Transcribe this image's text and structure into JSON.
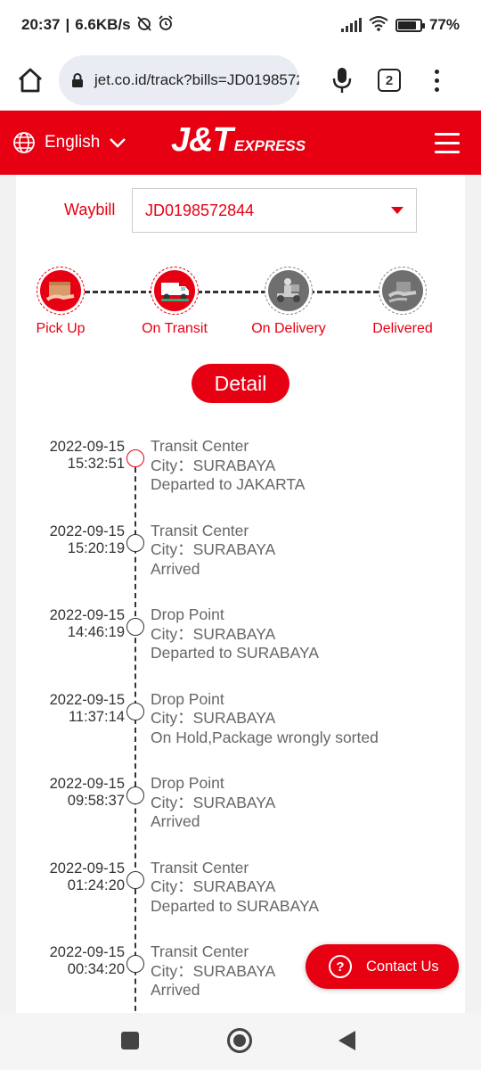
{
  "status_bar": {
    "time": "20:37",
    "network_speed": "6.6KB/s",
    "battery": "77",
    "battery_fraction": 0.77
  },
  "browser": {
    "url": "jet.co.id/track?bills=JD0198572",
    "tab_count": "2"
  },
  "header": {
    "language": "English",
    "logo_main": "J&T",
    "logo_sub": "EXPRESS"
  },
  "waybill": {
    "label": "Waybill",
    "value": "JD0198572844"
  },
  "steps": [
    {
      "label": "Pick Up",
      "icon": "pickup-package-icon",
      "active": true
    },
    {
      "label": "On Transit",
      "icon": "transit-truck-icon",
      "active": true
    },
    {
      "label": "On Delivery",
      "icon": "courier-scooter-icon",
      "active": false
    },
    {
      "label": "Delivered",
      "icon": "delivered-hands-icon",
      "active": false
    }
  ],
  "detail_button": "Detail",
  "timeline": [
    {
      "date": "2022-09-15",
      "time": "15:32:51",
      "place": "Transit Center",
      "city": "City：SURABAYA",
      "status": "Departed to JAKARTA"
    },
    {
      "date": "2022-09-15",
      "time": "15:20:19",
      "place": "Transit Center",
      "city": "City：SURABAYA",
      "status": "Arrived"
    },
    {
      "date": "2022-09-15",
      "time": "14:46:19",
      "place": "Drop Point",
      "city": "City：SURABAYA",
      "status": "Departed to SURABAYA"
    },
    {
      "date": "2022-09-15",
      "time": "11:37:14",
      "place": "Drop Point",
      "city": "City：SURABAYA",
      "status": "On Hold,Package wrongly sorted"
    },
    {
      "date": "2022-09-15",
      "time": "09:58:37",
      "place": "Drop Point",
      "city": "City：SURABAYA",
      "status": "Arrived"
    },
    {
      "date": "2022-09-15",
      "time": "01:24:20",
      "place": "Transit Center",
      "city": "City：SURABAYA",
      "status": "Departed to SURABAYA"
    },
    {
      "date": "2022-09-15",
      "time": "00:34:20",
      "place": "Transit Center",
      "city": "City：SURABAYA",
      "status": "Arrived"
    }
  ],
  "contact_button": "Contact Us",
  "colors": {
    "brand_red": "#e60012",
    "step_inactive": "#6f6f6f"
  }
}
